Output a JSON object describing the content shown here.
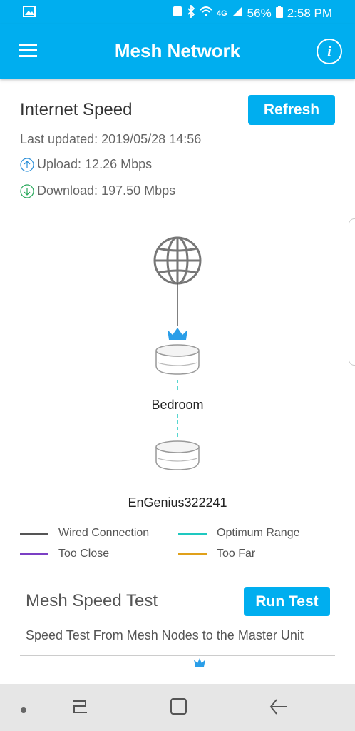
{
  "status_bar": {
    "battery": "56%",
    "time": "2:58 PM",
    "network": "4G"
  },
  "app_bar": {
    "title": "Mesh Network",
    "info_label": "i"
  },
  "internet_speed": {
    "title": "Internet Speed",
    "refresh_label": "Refresh",
    "last_updated": "Last updated: 2019/05/28 14:56",
    "upload": "Upload: 12.26 Mbps",
    "download": "Download: 197.50 Mbps"
  },
  "diagram": {
    "nodes": [
      {
        "label": "Bedroom"
      },
      {
        "label": "EnGenius322241"
      }
    ]
  },
  "legend": {
    "wired": "Wired Connection",
    "optimum": "Optimum Range",
    "too_close": "Too Close",
    "too_far": "Too Far",
    "colors": {
      "wired": "#555555",
      "optimum": "#1ec8c0",
      "too_close": "#7b3fc4",
      "too_far": "#e0a01a"
    }
  },
  "mesh_speed_test": {
    "title": "Mesh Speed Test",
    "run_label": "Run Test",
    "description": "Speed Test From Mesh Nodes to the Master Unit"
  },
  "colors": {
    "accent": "#00aeef"
  }
}
